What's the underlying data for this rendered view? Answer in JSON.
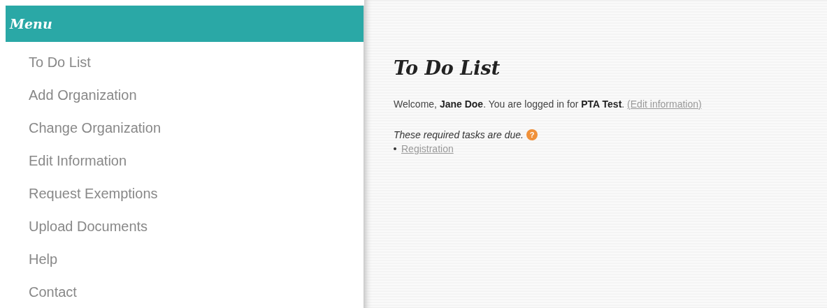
{
  "sidebar": {
    "title": "Menu",
    "items": [
      {
        "label": "To Do List"
      },
      {
        "label": "Add Organization"
      },
      {
        "label": "Change Organization"
      },
      {
        "label": "Edit Information"
      },
      {
        "label": "Request Exemptions"
      },
      {
        "label": "Upload Documents"
      },
      {
        "label": "Help"
      },
      {
        "label": "Contact"
      }
    ]
  },
  "main": {
    "heading": "To Do List",
    "welcome": "Welcome, **Jane Doe**. You are logged in for **PTA Test**.",
    "edit_link": "(Edit information)",
    "tasks_note": "These required tasks are due.",
    "help_badge": "?",
    "tasks": [
      {
        "label": "Registration"
      }
    ]
  }
}
